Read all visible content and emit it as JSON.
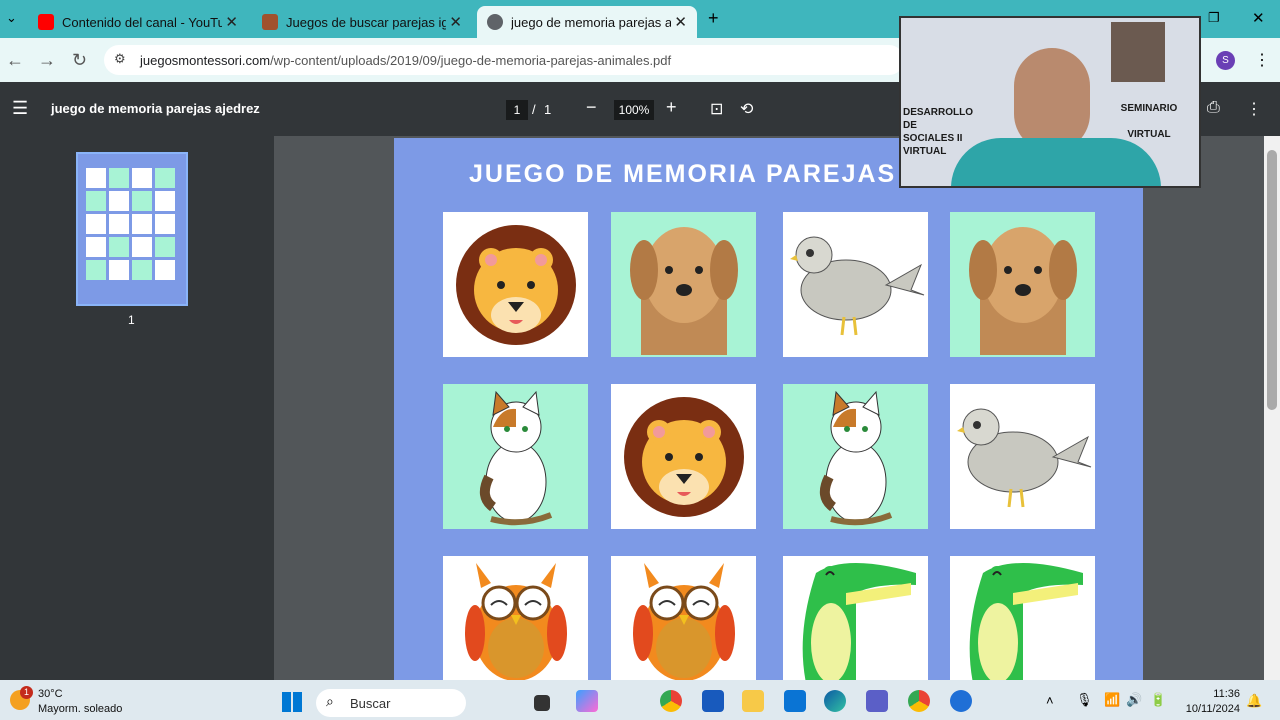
{
  "tabs": [
    {
      "title": "Contenido del canal - YouTube",
      "color": "#ff0000"
    },
    {
      "title": "Juegos de buscar parejas igual…",
      "color": "#a0522d"
    },
    {
      "title": "juego de memoria parejas ajed…",
      "color": "#5f6368"
    }
  ],
  "address": {
    "host": "juegosmontessori.com",
    "path": "/wp-content/uploads/2019/09/juego-de-memoria-parejas-animales.pdf"
  },
  "pdf": {
    "doc_title": "juego de memoria parejas ajedrez",
    "page": "1",
    "sep": "/",
    "total": "1",
    "zoom": "100%",
    "thumb_label": "1"
  },
  "page": {
    "title": "JUEGO DE MEMORIA PAREJAS"
  },
  "cards": [
    {
      "animal": "lion",
      "bg": "#ffffff"
    },
    {
      "animal": "dog",
      "bg": "#a8f3d5"
    },
    {
      "animal": "bird",
      "bg": "#ffffff"
    },
    {
      "animal": "dog",
      "bg": "#a8f3d5"
    },
    {
      "animal": "cat",
      "bg": "#a8f3d5"
    },
    {
      "animal": "lion",
      "bg": "#ffffff"
    },
    {
      "animal": "cat",
      "bg": "#a8f3d5"
    },
    {
      "animal": "bird",
      "bg": "#ffffff"
    },
    {
      "animal": "owl",
      "bg": "#ffffff"
    },
    {
      "animal": "owl",
      "bg": "#ffffff"
    },
    {
      "animal": "crocodile",
      "bg": "#ffffff"
    },
    {
      "animal": "crocodile",
      "bg": "#ffffff"
    }
  ],
  "webcam": {
    "sign_left": "DESARROLLO DE SOCIALES II VIRTUAL",
    "sign_right": "SEMINARIO VIRTUAL"
  },
  "taskbar": {
    "temp": "30°C",
    "weather": "Mayorm. soleado",
    "search": "Buscar",
    "time": "11:36",
    "date": "10/11/2024",
    "badge": "1"
  }
}
